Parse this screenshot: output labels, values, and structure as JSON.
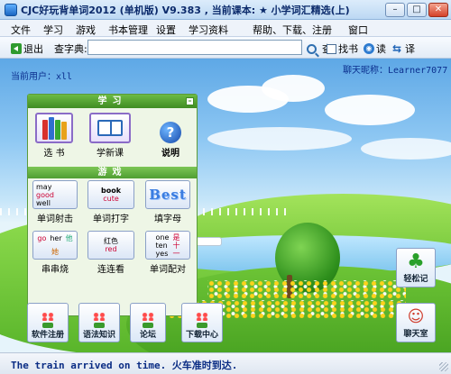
{
  "window": {
    "title": "CJC好玩背单词2012 (单机版) V9.383 , 当前课本: ★ 小学词汇精选(上)",
    "buttons": {
      "minimize": "–",
      "maximize": "□",
      "close": "✕"
    }
  },
  "menubar": {
    "items": [
      "文件",
      "学习",
      "游戏",
      "书本管理",
      "设置",
      "学习资料",
      "帮助、下载、注册",
      "窗口"
    ]
  },
  "toolbar": {
    "exit_label": "退出",
    "lookup_label": "查字典:",
    "search_value": "",
    "search_button": "查",
    "find_book_label": "找书",
    "read_label": "读",
    "translate_label": "译"
  },
  "main": {
    "current_user_label": "当前用户：xll",
    "chat_nickname": "聊天昵称：Learner7077"
  },
  "panel": {
    "study_header": "学习",
    "collapse": "–",
    "study_items": [
      {
        "label": "选 书",
        "icon": "books-icon"
      },
      {
        "label": "学新课",
        "icon": "open-book-icon"
      },
      {
        "label": "说明",
        "icon": "help-icon"
      }
    ],
    "games_header": "游戏",
    "game_items": [
      {
        "label": "单词射击",
        "icon_text": [
          "may",
          "good",
          "well"
        ]
      },
      {
        "label": "单词打字",
        "icon_text": [
          "book",
          "cute"
        ]
      },
      {
        "label": "填字母",
        "icon_text": [
          "Best"
        ]
      },
      {
        "label": "串串烧",
        "icon_text": [
          "go",
          "her",
          "他",
          "她"
        ]
      },
      {
        "label": "连连看",
        "icon_text": [
          "红色",
          "red"
        ]
      },
      {
        "label": "单词配对",
        "icon_text": [
          "one",
          "ten",
          "yes",
          "是",
          "十",
          "一"
        ]
      }
    ]
  },
  "side": {
    "notes_label": "轻松记",
    "chat_label": "聊天室"
  },
  "bottom": {
    "items": [
      "软件注册",
      "语法知识",
      "论坛",
      "下载中心"
    ]
  },
  "status": {
    "text": "The train arrived on time.  火车准时到达."
  }
}
